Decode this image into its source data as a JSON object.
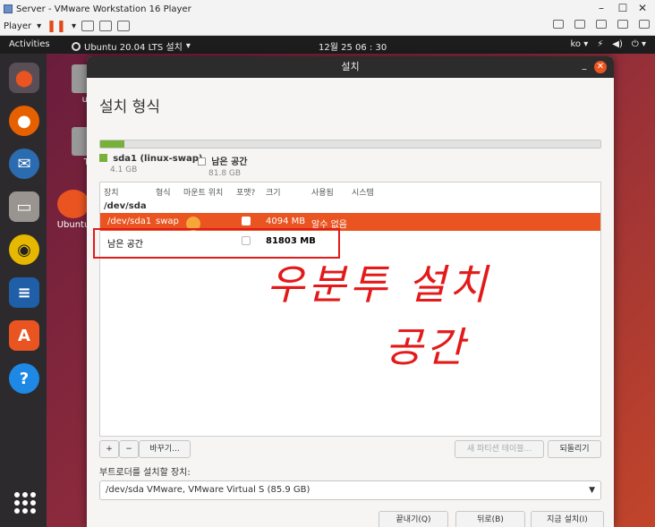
{
  "vm": {
    "title": "Server - VMware Workstation 16 Player",
    "player_menu": "Player"
  },
  "topbar": {
    "activities": "Activities",
    "app": "Ubuntu 20.04 LTS 설치",
    "clock": "12월 25  06 : 30",
    "lang": "ko"
  },
  "desktop_icons": [
    {
      "label": "ub"
    },
    {
      "label": "Tr"
    },
    {
      "label": "Ubuntu"
    }
  ],
  "dialog": {
    "header": "설치",
    "title": "설치 형식",
    "usage_bar": {
      "used_fraction": 0.048
    },
    "legend": [
      {
        "name": "sda1 (linux-swap)",
        "size": "4.1 GB",
        "color": "#77b13a"
      },
      {
        "name": "남은 공간",
        "size": "81.8 GB",
        "color": "#ffffff"
      }
    ],
    "columns": [
      "장치",
      "형식",
      "마운트 위치",
      "포맷?",
      "크기",
      "사용됨",
      "시스템"
    ],
    "device": "/dev/sda",
    "rows": [
      {
        "device": "/dev/sda1",
        "type": "swap",
        "mount": "",
        "size": "4094 MB",
        "used": "알수 없음",
        "selected": true
      },
      {
        "device": "남은 공간",
        "type": "",
        "mount": "",
        "size": "81803 MB",
        "used": "",
        "selected": false
      }
    ],
    "buttons": {
      "add": "+",
      "remove": "−",
      "change": "바꾸기...",
      "new_table": "새 파티션 테이블...",
      "revert": "되돌리기",
      "quit": "끝내기(Q)",
      "back": "뒤로(B)",
      "install": "지금 설치(I)"
    },
    "bootloader_label": "부트로더를 설치할 장치:",
    "bootloader_value": "/dev/sda VMware, VMware Virtual S (85.9 GB)"
  },
  "annotation": {
    "line1": "우분투 설치",
    "line2": "공간",
    "color": "#e21a1a"
  }
}
